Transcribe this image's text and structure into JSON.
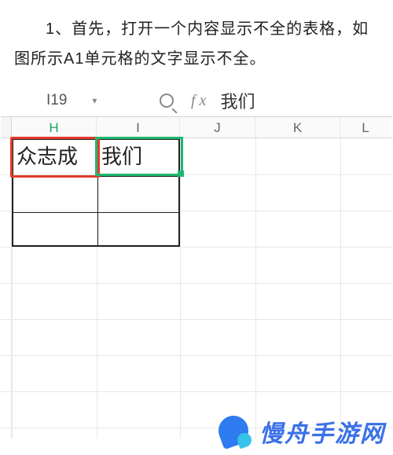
{
  "instruction": "1、首先，打开一个内容显示不全的表格，如图所示A1单元格的文字显示不全。",
  "formula_bar": {
    "namebox": "I19",
    "dropdown_glyph": "▾",
    "fx_label": "f x",
    "value": "我们"
  },
  "columns": {
    "H": "H",
    "I": "I",
    "J": "J",
    "K": "K",
    "L": "L"
  },
  "cells": {
    "H_text": "众志成",
    "I_text": "我们"
  },
  "icons": {
    "magnifier": "search-icon"
  },
  "watermark": {
    "text": "慢舟手游网"
  }
}
